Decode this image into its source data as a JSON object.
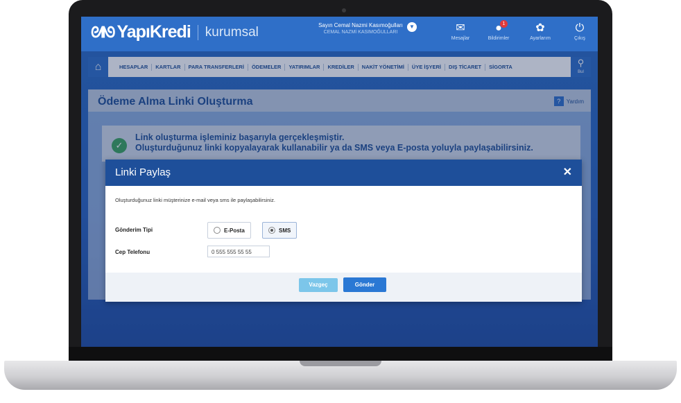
{
  "header": {
    "logo_mark": "ᘛᘚ",
    "brand": "YapıKredi",
    "sub": "kurumsal",
    "user_line1": "Sayın Cemal Nazmi Kasımoğulları",
    "user_line2": "CEMAL NAZMİ KASIMOĞULLARI",
    "icons": [
      {
        "name": "mail-icon",
        "glyph": "✉",
        "label": "Mesajlar"
      },
      {
        "name": "notification-icon",
        "glyph": "●",
        "label": "Bildirimler",
        "badge": "1"
      },
      {
        "name": "settings-icon",
        "glyph": "✿",
        "label": "Ayarlarım"
      },
      {
        "name": "power-icon",
        "glyph": "⏻",
        "label": "Çıkış"
      }
    ]
  },
  "nav": {
    "home_glyph": "⌂",
    "items": [
      "HESAPLAR",
      "KARTLAR",
      "PARA TRANSFERLERİ",
      "ÖDEMELER",
      "YATIRIMLAR",
      "KREDİLER",
      "NAKİT YÖNETİMİ",
      "ÜYE İŞYERİ",
      "DIŞ TİCARET",
      "SİGORTA"
    ],
    "search_glyph": "⚲",
    "search_label": "Bul"
  },
  "page": {
    "title": "Ödeme Alma Linki Oluşturma",
    "help_glyph": "?",
    "help_label": "Yardım"
  },
  "success": {
    "glyph": "✓",
    "line1": "Link oluşturma işleminiz başarıyla gerçekleşmiştir.",
    "line2": "Oluşturduğunuz linki kopyalayarak kullanabilir ya da SMS veya E-posta yoluyla paylaşabilirsiniz."
  },
  "modal": {
    "title": "Linki Paylaş",
    "close_glyph": "✕",
    "description": "Oluşturduğunuz linki müşterinize e-mail veya sms ile paylaşabilirsiniz.",
    "send_type_label": "Gönderim Tipi",
    "options": {
      "email": "E-Posta",
      "sms": "SMS"
    },
    "selected": "SMS",
    "phone_label": "Cep Telefonu",
    "phone_value": "0 555 555 55 55",
    "cancel_label": "Vazgeç",
    "send_label": "Gönder"
  },
  "colors": {
    "primary": "#2f6fc8",
    "modal_header": "#1e4f9a",
    "success": "#3da35d",
    "cancel_button": "#7cc6ea",
    "send_button": "#2a78d4"
  }
}
